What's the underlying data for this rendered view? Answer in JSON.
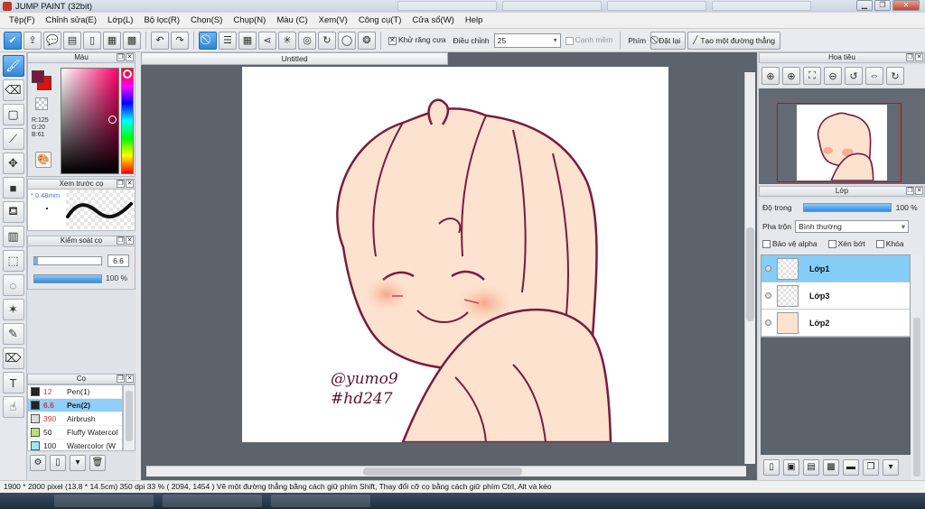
{
  "window": {
    "title": "JUMP PAINT (32bit)"
  },
  "menu": [
    "Tệp(F)",
    "Chỉnh sửa(E)",
    "Lớp(L)",
    "Bộ lọc(R)",
    "Chọn(S)",
    "Chụp(N)",
    "Màu (C)",
    "Xem(V)",
    "Công cụ(T)",
    "Cửa sổ(W)",
    "Help"
  ],
  "toolbar": {
    "antialias_label": "Khử răng cưa",
    "adjust_label": "Điều chỉnh",
    "adjust_value": "25",
    "edge_label": "Cạnh mềm",
    "key_label": "Phím",
    "reset_label": "Đặt lại",
    "straight_line_label": "Tạo một đường thẳng"
  },
  "color_panel": {
    "title": "Màu",
    "r": "R:125",
    "g": "G:20",
    "b": "B:61",
    "fg": "#7d143d",
    "bg": "#e01010"
  },
  "brush_preview": {
    "title": "Xem trước cọ",
    "size": "* 0.48mm"
  },
  "brush_control": {
    "title": "Kiểm soát cọ",
    "size": "6.6",
    "size_fraction": 0.05,
    "opacity": "100 %",
    "opacity_fraction": 1.0
  },
  "brush_panel": {
    "title": "Cọ",
    "items": [
      {
        "size": "12",
        "name": "Pen(1)",
        "swatch": "#222222"
      },
      {
        "size": "6.6",
        "name": "Pen(2)",
        "swatch": "#222222"
      },
      {
        "size": "390",
        "name": "Airbrush",
        "swatch": "#dddddd"
      },
      {
        "size": "50",
        "name": "Fluffy Watercol",
        "swatch": "#b8e07a"
      },
      {
        "size": "100",
        "name": "Watercolor (W",
        "swatch": "#9fe6f2"
      }
    ]
  },
  "canvas": {
    "tab_title": "Untitled",
    "signature_1": "@yumo9",
    "signature_2": "#hd247"
  },
  "navigator": {
    "title": "Hoa tiêu"
  },
  "layers": {
    "title": "Lớp",
    "opacity_label": "Độ trong",
    "opacity_value": "100 %",
    "blend_label": "Pha trộn",
    "blend_value": "Bình thường",
    "protect_alpha": "Bảo vệ alpha",
    "clipping": "Xén bớt",
    "lock": "Khóa",
    "items": [
      {
        "name": "Lớp1",
        "selected": true
      },
      {
        "name": "Lớp3",
        "selected": false
      },
      {
        "name": "Lớp2",
        "selected": false
      }
    ]
  },
  "status": {
    "text": "1900 * 2000 pixel   (13.8 * 14.5cm)   350 dpi   33 %   ( 2094, 1454 )   Vẽ một đường thẳng bằng cách giữ phím Shift, Thay đổi cỡ cọ bằng cách giữ phím Ctrl, Alt và kéo"
  }
}
